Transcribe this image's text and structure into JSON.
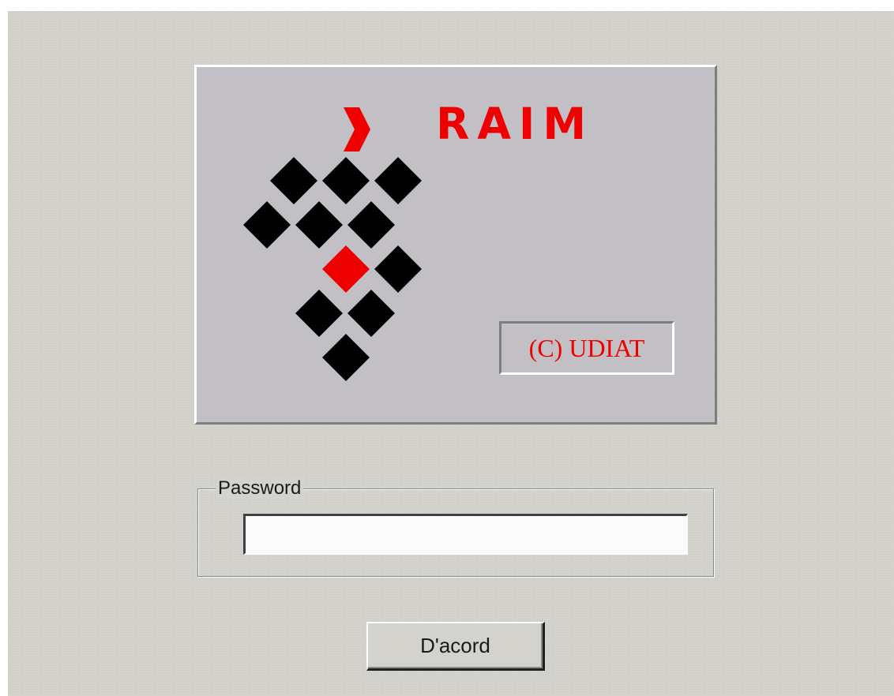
{
  "logo": {
    "title": "RAIM",
    "copyright": "(C) UDIAT",
    "icon": "raim-diamond-grid-logo",
    "colors": {
      "accent": "#ee0000",
      "diamond": "#000000",
      "panel": "#c2c0c4"
    }
  },
  "password_group": {
    "legend": "Password",
    "value": "",
    "placeholder": ""
  },
  "ok_button": {
    "label": "D'acord"
  }
}
